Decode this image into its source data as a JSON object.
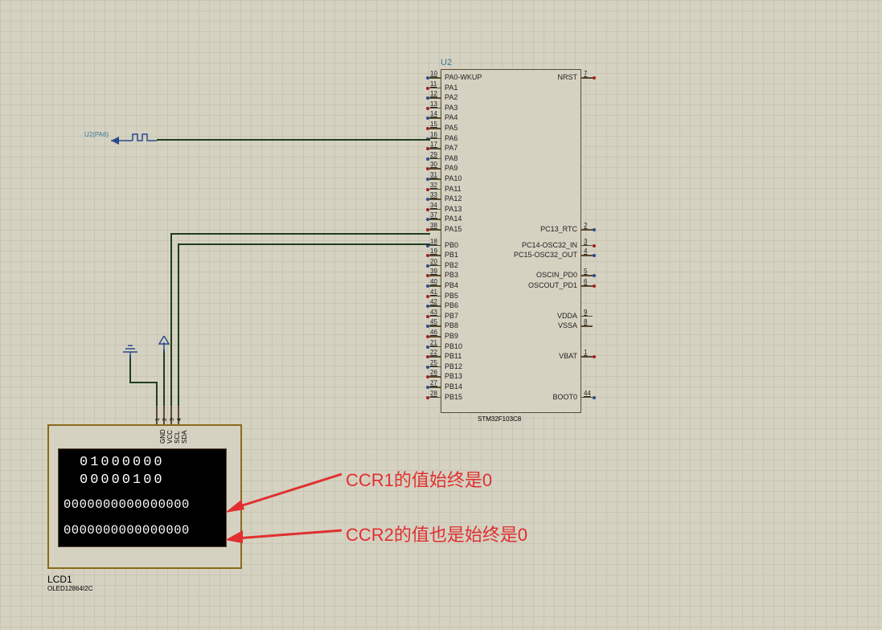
{
  "chip": {
    "ref": "U2",
    "part": "STM32F103C8",
    "left_pins": [
      {
        "num": "10",
        "name": "PA0-WKUP"
      },
      {
        "num": "11",
        "name": "PA1"
      },
      {
        "num": "12",
        "name": "PA2"
      },
      {
        "num": "13",
        "name": "PA3"
      },
      {
        "num": "14",
        "name": "PA4"
      },
      {
        "num": "15",
        "name": "PA5"
      },
      {
        "num": "16",
        "name": "PA6"
      },
      {
        "num": "17",
        "name": "PA7"
      },
      {
        "num": "29",
        "name": "PA8"
      },
      {
        "num": "30",
        "name": "PA9"
      },
      {
        "num": "31",
        "name": "PA10"
      },
      {
        "num": "32",
        "name": "PA11"
      },
      {
        "num": "33",
        "name": "PA12"
      },
      {
        "num": "34",
        "name": "PA13"
      },
      {
        "num": "37",
        "name": "PA14"
      },
      {
        "num": "38",
        "name": "PA15"
      },
      {
        "num": "18",
        "name": "PB0"
      },
      {
        "num": "19",
        "name": "PB1"
      },
      {
        "num": "20",
        "name": "PB2"
      },
      {
        "num": "39",
        "name": "PB3"
      },
      {
        "num": "40",
        "name": "PB4"
      },
      {
        "num": "41",
        "name": "PB5"
      },
      {
        "num": "42",
        "name": "PB6"
      },
      {
        "num": "43",
        "name": "PB7"
      },
      {
        "num": "45",
        "name": "PB8"
      },
      {
        "num": "46",
        "name": "PB9"
      },
      {
        "num": "21",
        "name": "PB10"
      },
      {
        "num": "22",
        "name": "PB11"
      },
      {
        "num": "25",
        "name": "PB12"
      },
      {
        "num": "26",
        "name": "PB13"
      },
      {
        "num": "27",
        "name": "PB14"
      },
      {
        "num": "28",
        "name": "PB15"
      }
    ],
    "right_pins": [
      {
        "num": "7",
        "name": "NRST",
        "row": 0,
        "color": "red"
      },
      {
        "num": "2",
        "name": "PC13_RTC",
        "row": 15,
        "color": "blue"
      },
      {
        "num": "3",
        "name": "PC14-OSC32_IN",
        "row": 16,
        "color": "red"
      },
      {
        "num": "4",
        "name": "PC15-OSC32_OUT",
        "row": 17,
        "color": "blue"
      },
      {
        "num": "5",
        "name": "OSCIN_PD0",
        "row": 19,
        "color": "blue"
      },
      {
        "num": "6",
        "name": "OSCOUT_PD1",
        "row": 20,
        "color": "red"
      },
      {
        "num": "9",
        "name": "VDDA",
        "row": 23,
        "color": null
      },
      {
        "num": "8",
        "name": "VSSA",
        "row": 24,
        "color": null
      },
      {
        "num": "1",
        "name": "VBAT",
        "row": 27,
        "color": "red"
      },
      {
        "num": "44",
        "name": "BOOT0",
        "row": 31,
        "color": "blue"
      }
    ]
  },
  "lcd": {
    "ref": "LCD1",
    "part": "OLED12864I2C",
    "pins": [
      "GND",
      "VCC",
      "SCL",
      "SDA"
    ],
    "pin_nums": [
      "1",
      "2",
      "3",
      "4"
    ],
    "lines": [
      "01000000",
      "00000100",
      "0000000000000000",
      "0000000000000000"
    ]
  },
  "signal": {
    "label": "U2(PA6)"
  },
  "annotations": {
    "a1": "CCR1的值始终是0",
    "a2": "CCR2的值也是始终是0"
  }
}
